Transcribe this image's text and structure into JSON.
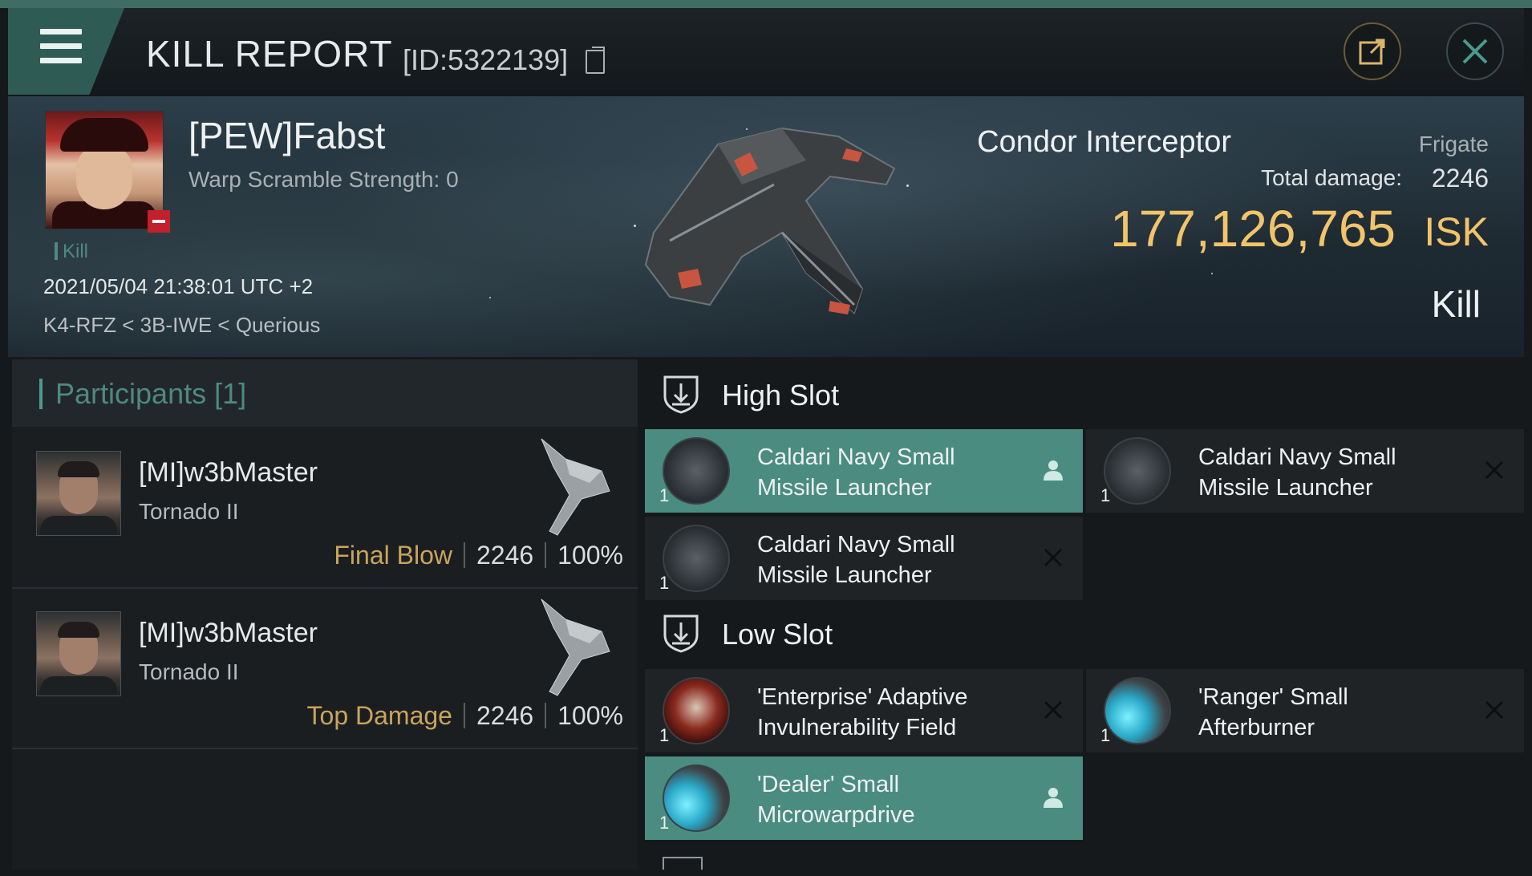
{
  "header": {
    "title": "KILL REPORT",
    "id": "[ID:5322139]"
  },
  "victim": {
    "name": "[PEW]Fabst",
    "warp_scramble": "Warp Scramble Strength: 0",
    "tag": "Kill",
    "timestamp": "2021/05/04 21:38:01 UTC +2",
    "location": "K4-RFZ < 3B-IWE < Querious",
    "ship_name": "Condor Interceptor",
    "ship_class": "Frigate",
    "total_damage_label": "Total damage:",
    "total_damage": "2246",
    "isk_value": "177,126,765",
    "isk_unit": "ISK",
    "result": "Kill"
  },
  "participants": {
    "title": "Participants [1]",
    "rows": [
      {
        "name": "[MI]w3bMaster",
        "ship": "Tornado II",
        "role": "Final Blow",
        "damage": "2246",
        "percent": "100%"
      },
      {
        "name": "[MI]w3bMaster",
        "ship": "Tornado II",
        "role": "Top Damage",
        "damage": "2246",
        "percent": "100%"
      }
    ]
  },
  "fitting": {
    "high_slot": {
      "title": "High Slot",
      "modules": [
        {
          "qty": "1",
          "line1": "Caldari Navy Small",
          "line2": "Missile Launcher",
          "status": "dropped"
        },
        {
          "qty": "1",
          "line1": "Caldari Navy Small",
          "line2": "Missile Launcher",
          "status": "destroyed"
        },
        {
          "qty": "1",
          "line1": "Caldari Navy Small",
          "line2": "Missile Launcher",
          "status": "destroyed"
        }
      ]
    },
    "low_slot": {
      "title": "Low Slot",
      "modules": [
        {
          "qty": "1",
          "line1": "'Enterprise' Adaptive",
          "line2": "Invulnerability Field",
          "status": "destroyed"
        },
        {
          "qty": "1",
          "line1": "'Ranger' Small",
          "line2": "Afterburner",
          "status": "destroyed"
        },
        {
          "qty": "1",
          "line1": "'Dealer' Small",
          "line2": "Microwarpdrive",
          "status": "dropped"
        }
      ]
    }
  },
  "colors": {
    "accent": "#4a8c80",
    "isk": "#f2c46a",
    "role": "#c9a45c"
  },
  "icons": [
    "menu-icon",
    "copy-icon",
    "share-icon",
    "close-icon",
    "high-slot-icon",
    "low-slot-icon",
    "person-icon",
    "cross-icon"
  ]
}
